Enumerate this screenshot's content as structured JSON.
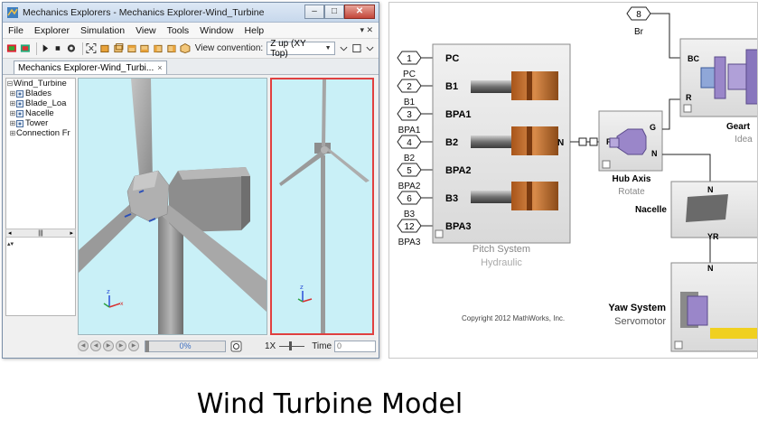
{
  "window": {
    "title": "Mechanics Explorers - Mechanics Explorer-Wind_Turbine",
    "btn_min": "–",
    "btn_max": "□",
    "btn_close": "✕"
  },
  "menu": {
    "items": [
      "File",
      "Explorer",
      "Simulation",
      "View",
      "Tools",
      "Window",
      "Help"
    ],
    "right_controls": "▾ ✕"
  },
  "toolbar": {
    "view_convention_label": "View convention:",
    "view_convention_value": "Z up (XY Top)"
  },
  "tab": {
    "label": "Mechanics Explorer-Wind_Turbi...",
    "close": "×"
  },
  "tree": {
    "items": [
      {
        "label": "Wind_Turbine",
        "exp": "⊟"
      },
      {
        "label": "Blades",
        "exp": "⊞"
      },
      {
        "label": "Blade_Loa",
        "exp": "⊞"
      },
      {
        "label": "Nacelle",
        "exp": "⊞"
      },
      {
        "label": "Tower",
        "exp": "⊞"
      },
      {
        "label": "Connection Fr",
        "exp": "⊞"
      }
    ],
    "scroll_text": "|||",
    "scroll_left": "◂",
    "scroll_right": "▸",
    "split": "▴▾"
  },
  "playback": {
    "progress_text": "0%",
    "progress": 0,
    "speed": "1X",
    "time_label": "Time",
    "time_value": "0"
  },
  "model": {
    "inports": [
      {
        "num": "1",
        "name": "PC",
        "sub": "PC"
      },
      {
        "num": "2",
        "name": "B1",
        "sub": "B1"
      },
      {
        "num": "3",
        "name": "BPA1",
        "sub": "BPA1"
      },
      {
        "num": "4",
        "name": "B2",
        "sub": "B2"
      },
      {
        "num": "5",
        "name": "BPA2",
        "sub": "BPA2"
      },
      {
        "num": "6",
        "name": "B3",
        "sub": "B3"
      },
      {
        "num": "12",
        "name": "BPA3",
        "sub": "BPA3"
      }
    ],
    "br_port": {
      "num": "8",
      "name": "Br"
    },
    "pitch_system": {
      "title": "Pitch System",
      "subtitle": "Hydraulic",
      "port": "N"
    },
    "hub_axis": {
      "title": "Hub Axis",
      "subtitle": "Rotate",
      "port_r": "R",
      "port_g": "G",
      "port_n": "N"
    },
    "gear": {
      "title": "Geart",
      "subtitle": "Idea",
      "port_bc": "BC",
      "port_r": "R"
    },
    "nacelle": {
      "title": "Nacelle",
      "port_n": "N"
    },
    "yaw": {
      "title": "Yaw System",
      "subtitle": "Servomotor",
      "port_yr": "YR",
      "port_n": "N"
    },
    "copyright": "Copyright 2012 MathWorks, Inc."
  },
  "caption": "Wind Turbine Model"
}
